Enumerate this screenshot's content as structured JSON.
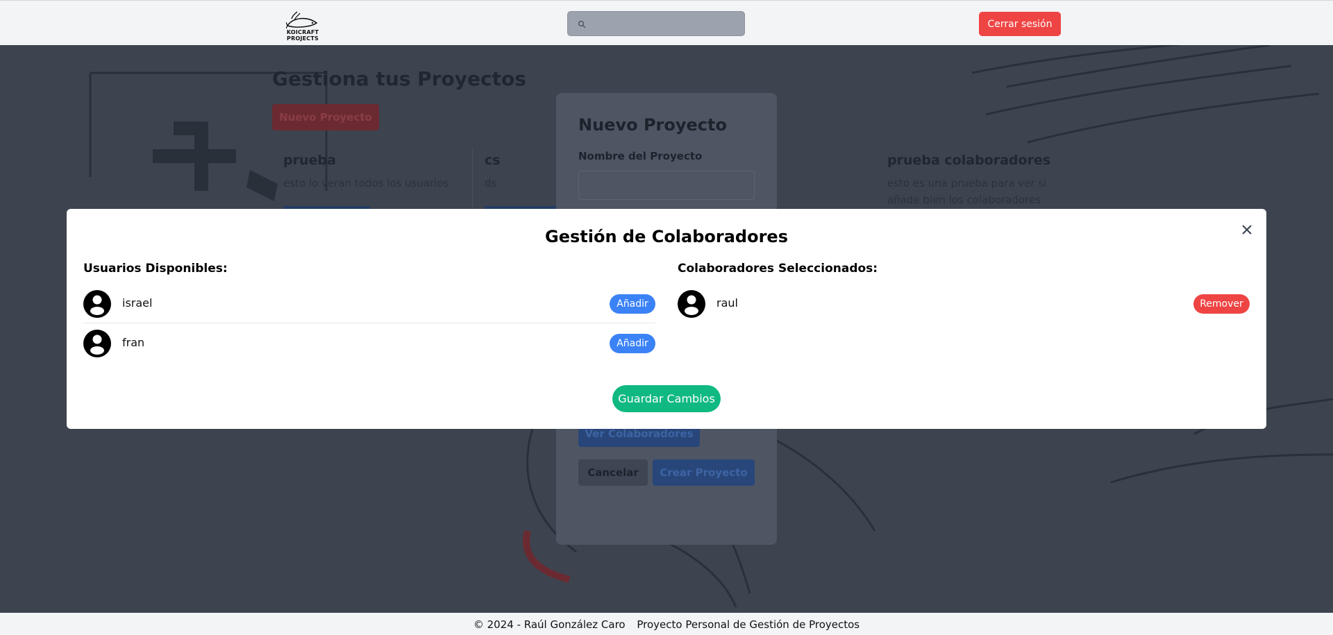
{
  "header": {
    "logo_text": "KOICRAFT PROJECTS",
    "search_placeholder": "",
    "logout_label": "Cerrar sesión"
  },
  "background": {
    "page_title": "Gestiona tus Proyectos",
    "new_project_label": "Nuevo Proyecto",
    "cards": [
      {
        "title": "prueba",
        "description": "esto lo veran todos los usuarios"
      },
      {
        "title": "cs",
        "description": "ds"
      },
      {
        "title": "prueba colaboradores",
        "description": "esto es una prueba para ver si añade bien los colaboradores"
      }
    ],
    "form": {
      "title": "Nuevo Proyecto",
      "name_label": "Nombre del Proyecto",
      "view_collaborators_label": "Ver Colaboradores",
      "cancel_label": "Cancelar",
      "create_label": "Crear Proyecto"
    }
  },
  "modal": {
    "title": "Gestión de Colaboradores",
    "available_heading": "Usuarios Disponibles:",
    "selected_heading": "Colaboradores Seleccionados:",
    "available_users": [
      {
        "name": "israel",
        "action_label": "Añadir"
      },
      {
        "name": "fran",
        "action_label": "Añadir"
      }
    ],
    "selected_users": [
      {
        "name": "raul",
        "action_label": "Remover"
      }
    ],
    "save_label": "Guardar Cambios"
  },
  "footer": {
    "copyright": "© 2024 - Raúl González Caro",
    "tagline": "Proyecto Personal de Gestión de Proyectos"
  },
  "colors": {
    "primary": "#3b82f6",
    "danger": "#ef4444",
    "success": "#10b981",
    "overlay": "#3d4450"
  }
}
